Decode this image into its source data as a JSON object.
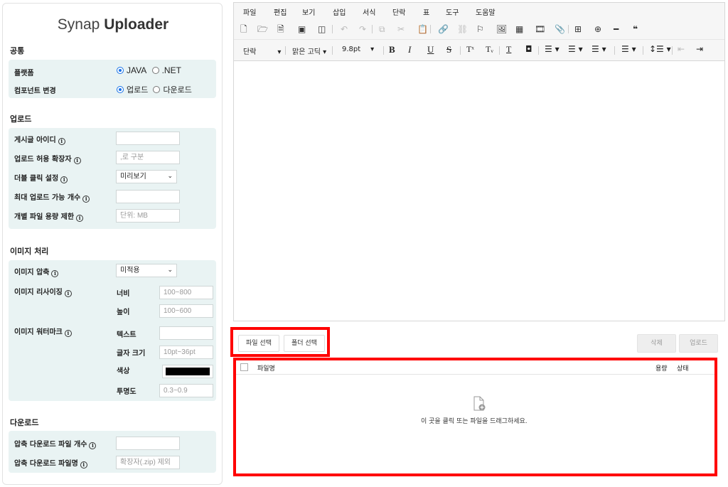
{
  "title": {
    "light": "Synap ",
    "bold": "Uploader"
  },
  "common": {
    "title": "공통",
    "platform_label": "플랫폼",
    "platform_options": [
      "JAVA",
      ".NET"
    ],
    "component_label": "컴포넌트 변경",
    "component_options": [
      "업로드",
      "다운로드"
    ]
  },
  "upload": {
    "title": "업로드",
    "post_id_label": "게시글 아이디",
    "ext_label": "업로드 허용 확장자",
    "ext_placeholder": ",로 구분",
    "dblclick_label": "더블 클릭 설정",
    "dblclick_value": "미리보기",
    "max_count_label": "최대 업로드 가능 개수",
    "size_limit_label": "개별 파일 용량 제한",
    "size_limit_placeholder": "단위: MB"
  },
  "image": {
    "title": "이미지 처리",
    "compress_label": "이미지 압축",
    "compress_value": "미적용",
    "resize_label": "이미지 리사이징",
    "width_label": "너비",
    "width_placeholder": "100~800",
    "height_label": "높이",
    "height_placeholder": "100~600",
    "watermark_label": "이미지 워터마크",
    "text_label": "텍스트",
    "font_size_label": "글자 크기",
    "font_size_placeholder": "10pt~36pt",
    "color_label": "색상",
    "color_value": "#000000",
    "opacity_label": "투명도",
    "opacity_placeholder": "0.3~0.9"
  },
  "download": {
    "title": "다운로드",
    "zip_count_label": "압축 다운로드 파일 개수",
    "zip_name_label": "압축 다운로드 파일명",
    "zip_name_placeholder": "확장자(.zip) 제외"
  },
  "editor": {
    "menu": [
      "파일",
      "편집",
      "보기",
      "삽입",
      "서식",
      "단락",
      "표",
      "도구",
      "도움말"
    ],
    "paragraph_style": "단락",
    "font_family": "맑은 고딕",
    "font_size": "9.8pt"
  },
  "uploader": {
    "select_file": "파일 선택",
    "select_folder": "폴더 선택",
    "delete": "삭제",
    "upload": "업로드",
    "col_name": "파일명",
    "col_size": "용량",
    "col_status": "상태",
    "drop_message": "이 곳을 클릭 또는 파일을 드래그하세요."
  },
  "colors": {
    "accent": "#1a73e8",
    "highlight": "#ff0000",
    "panel_bg": "#e9f3f3"
  }
}
